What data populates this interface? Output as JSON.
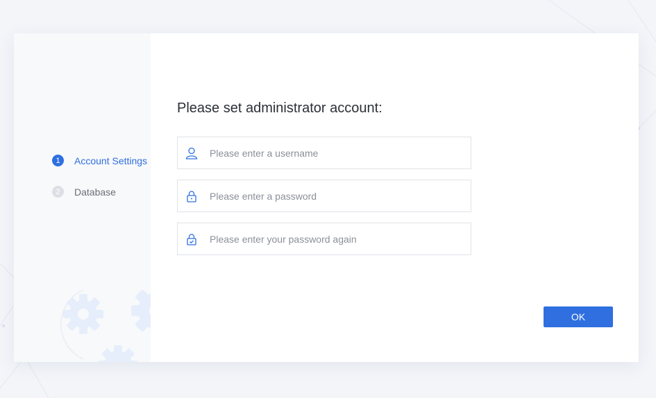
{
  "steps": [
    {
      "number": "1",
      "label": "Account Settings",
      "state": "active"
    },
    {
      "number": "2",
      "label": "Database",
      "state": "inactive"
    }
  ],
  "form": {
    "title": "Please set administrator account:",
    "username": {
      "value": "",
      "placeholder": "Please enter a username",
      "icon": "user-icon"
    },
    "password": {
      "value": "",
      "placeholder": "Please enter a password",
      "icon": "lock-icon"
    },
    "password_confirm": {
      "value": "",
      "placeholder": "Please enter your password again",
      "icon": "lock-check-icon"
    },
    "ok_label": "OK"
  },
  "colors": {
    "accent": "#2f6fe0",
    "background": "#f3f5f9",
    "panel": "#f8f9fb",
    "gear": "#e6eefb"
  }
}
